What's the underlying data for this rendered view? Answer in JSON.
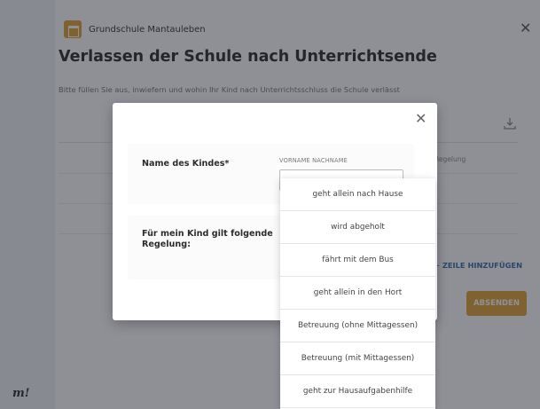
{
  "app": {
    "brand": "m!",
    "school_name": "Grundschule Mantauleben"
  },
  "form": {
    "title": "Verlassen der Schule nach Unterrichtsende",
    "subtitle": "Bitte füllen Sie aus, inwiefern und wohin Ihr Kind nach Unterrichtsschluss die Schule verlässt",
    "table_column_label": "Regelung",
    "add_row_label": "ZEILE HINZUFÜGEN",
    "submit_label": "ABSENDEN"
  },
  "modal": {
    "name_label": "Name des Kindes*",
    "name_hint": "VORNAME NACHNAME",
    "name_value": "",
    "rule_label": "Für mein Kind gilt folgende Regelung:"
  },
  "dropdown": {
    "options": [
      "geht allein nach Hause",
      "wird abgeholt",
      "fährt mit dem Bus",
      "geht allein in den Hort",
      "Betreuung (ohne Mittagessen)",
      "Betreuung (mit Mittagessen)",
      "geht zur Hausaufgabenhilfe"
    ]
  },
  "icons": {
    "close": "close-icon",
    "download": "download-icon",
    "add": "plus-icon",
    "school": "school-logo-icon"
  },
  "colors": {
    "accent": "#e3a237",
    "link": "#3a6aa8"
  }
}
